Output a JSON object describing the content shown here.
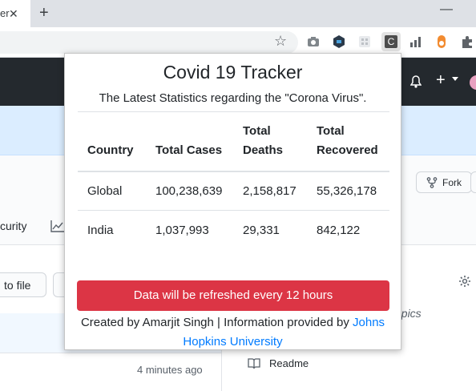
{
  "browser": {
    "tab_title": "er",
    "tab_close_glyph": "✕",
    "new_tab_glyph": "+",
    "minimize_glyph": "—",
    "bookmark_star_glyph": "☆",
    "extension_c_letter": "C",
    "icons": [
      "camera-icon",
      "hex-extension-icon",
      "grid-extension-icon",
      "covid-tracker-extension-icon",
      "bars-extension-icon",
      "toggle-extension-icon",
      "puzzle-icon"
    ]
  },
  "github": {
    "plus_glyph": "+",
    "fork_label": "Fork",
    "nav_security_label": "curity",
    "goto_file_label": "to file",
    "topics_text": "opics",
    "last_commit_time": "4 minutes ago",
    "readme_label": "Readme"
  },
  "popup": {
    "title": "Covid 19 Tracker",
    "subtitle": "The Latest Statistics regarding the \"Corona Virus\".",
    "table": {
      "headers": {
        "country": "Country",
        "total_cases": "Total Cases",
        "total_deaths_line1": "Total",
        "total_deaths_line2": "Deaths",
        "total_recovered_line1": "Total",
        "total_recovered_line2": "Recovered"
      },
      "rows": [
        {
          "country": "Global",
          "total_cases": "100,238,639",
          "total_deaths": "2,158,817",
          "total_recovered": "55,326,178"
        },
        {
          "country": "India",
          "total_cases": "1,037,993",
          "total_deaths": "29,331",
          "total_recovered": "842,122"
        }
      ]
    },
    "refresh_notice": "Data will be refreshed every 12 hours",
    "credit_prefix": "Created by Amarjit Singh | Information provided by",
    "credit_link_text": "Johns Hopkins University"
  },
  "colors": {
    "danger": "#dc3545",
    "link": "#007bff",
    "github_header": "#24292e"
  }
}
